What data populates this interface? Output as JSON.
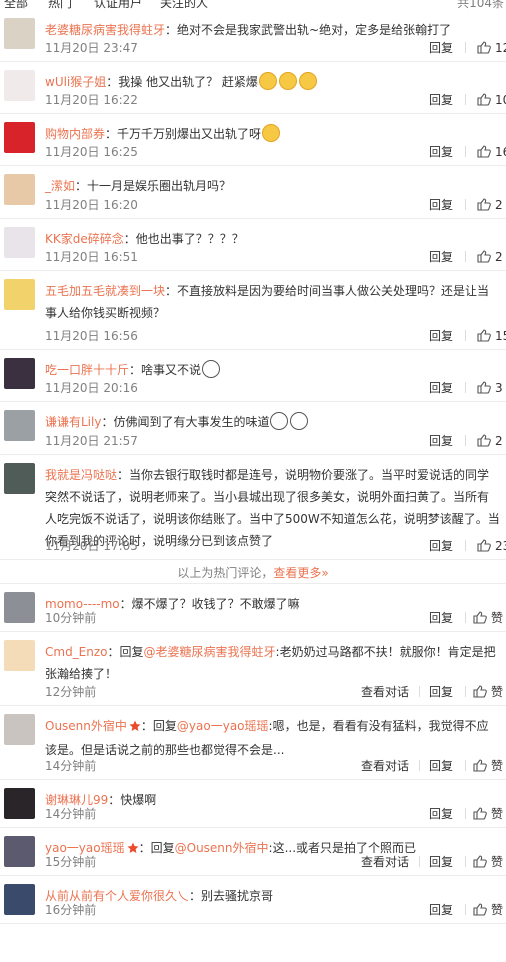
{
  "tabs": {
    "all": "全部",
    "hot": "热门",
    "verified": "认证用户",
    "following": "关注的人",
    "count": "共104条"
  },
  "like_icon": "thumb-up-icon",
  "hot_comments": [
    {
      "user": "老婆糖尿病害我得蛀牙",
      "text": "：绝对不会是我家武警出轨~绝对，定多是给张翰打了",
      "time": "11月20日 23:47",
      "reply": "回复",
      "likes": "12",
      "avatar_color": "#d9d2c5"
    },
    {
      "user": "wUli猴子姐",
      "text": "：我操  他又出轨了？  赶紧爆",
      "time": "11月20日 16:22",
      "reply": "回复",
      "likes": "10",
      "emoji_count": 3,
      "avatar_color": "#f0eaea"
    },
    {
      "user": "购物内部券",
      "text": "：千万千万别爆出又出轨了呀",
      "time": "11月20日 16:25",
      "reply": "回复",
      "likes": "16",
      "emoji_count": 1,
      "avatar_color": "#d8232a"
    },
    {
      "user": "_潆如",
      "text": "：十一月是娱乐圈出轨月吗？",
      "time": "11月20日 16:20",
      "reply": "回复",
      "likes": "2",
      "avatar_color": "#e7c9a8"
    },
    {
      "user": "KK家de碎碎念",
      "text": "：他也出事了？？？？",
      "time": "11月20日 16:51",
      "reply": "回复",
      "likes": "2",
      "avatar_color": "#e9e3ea"
    },
    {
      "user": "五毛加五毛就凑到一块",
      "text": "：不直接放料是因为要给时间当事人做公关处理吗？还是让当事人给你钱买断视频？",
      "time": "11月20日 16:56",
      "reply": "回复",
      "likes": "15",
      "avatar_color": "#f2d36b"
    },
    {
      "user": "吃一口胖十十斤",
      "text": "：啥事又不说",
      "time": "11月20日 20:16",
      "reply": "回复",
      "likes": "3",
      "emoji_count": 1,
      "avatar_color": "#3a3040"
    },
    {
      "user": "谦谦有Lily",
      "text": "：仿佛闻到了有大事发生的味道",
      "time": "11月20日 21:57",
      "reply": "回复",
      "likes": "2",
      "emoji_count": 2,
      "avatar_color": "#9aa0a3"
    },
    {
      "user": "我就是冯哒哒",
      "text": "：当你去银行取钱时都是连号，说明物价要涨了。当平时爱说话的同学突然不说话了，说明老师来了。当小县城出现了很多美女，说明外面扫黄了。当所有人吃完饭不说话了，说明该你结账了。当中了500W不知道怎么花，说明梦该醒了。当你看到我的评论时，说明缘分已到该点赞了",
      "time": "11月20日 17:05",
      "reply": "回复",
      "likes": "23",
      "avatar_color": "#4f5c57"
    }
  ],
  "hot_footer": {
    "text": "以上为热门评论，",
    "more": "查看更多»"
  },
  "recent_comments": [
    {
      "user": "momo----mo",
      "text": "：爆不爆了？收钱了？不敢爆了嘛",
      "time": "10分钟前",
      "reply": "回复",
      "like": "赞",
      "avatar_color": "#8d8f96"
    },
    {
      "user": "Cmd_Enzo",
      "text": "：回复",
      "at": "@老婆糖尿病害我得蛀牙",
      "text2": ":老奶奶过马路都不扶！就服你！肯定是把张瀚给揍了！",
      "time": "12分钟前",
      "view": "查看对话",
      "reply": "回复",
      "like": "赞",
      "avatar_color": "#f5dcb8"
    },
    {
      "user": "Ousenn外宿中",
      "text": "：回复",
      "at": "@yao一yao瑶瑶",
      "text2": ":嗯，也是，看看有没有猛料，我觉得不应该是。但是话说之前的那些也都觉得不会是...",
      "time": "14分钟前",
      "view": "查看对话",
      "reply": "回复",
      "like": "赞",
      "avatar_color": "#c9c4bf"
    },
    {
      "user": "谢琳琳儿99",
      "text": "：快爆啊",
      "time": "14分钟前",
      "reply": "回复",
      "like": "赞",
      "avatar_color": "#2a2528"
    },
    {
      "user": "yao一yao瑶瑶",
      "text": "：回复",
      "at": "@Ousenn外宿中",
      "text2": ":这...或者只是拍了个照而已",
      "time": "15分钟前",
      "view": "查看对话",
      "reply": "回复",
      "like": "赞",
      "avatar_color": "#5b5a6e"
    },
    {
      "user": "从前从前有个人爱你很久乀",
      "text": "：别去骚扰京哥",
      "time": "16分钟前",
      "reply": "回复",
      "like": "赞",
      "avatar_color": "#394a6a"
    }
  ]
}
